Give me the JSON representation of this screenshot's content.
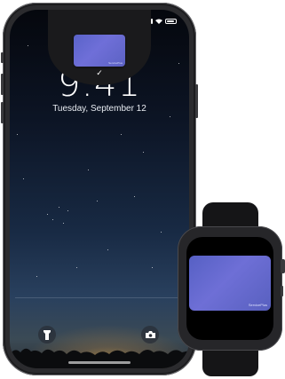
{
  "lock_screen": {
    "time": "9:41",
    "date": "Tuesday, September 12",
    "pay_confirm_mark": "✓",
    "card_brand": "ServicePlus"
  },
  "watch": {
    "card_brand": "ServicePlus"
  },
  "icons": {
    "flashlight": "flashlight-icon",
    "camera": "camera-icon",
    "checkmark": "checkmark-icon"
  },
  "colors": {
    "card": "#6366d1",
    "device_frame": "#2b2b2e",
    "band": "#151517"
  }
}
